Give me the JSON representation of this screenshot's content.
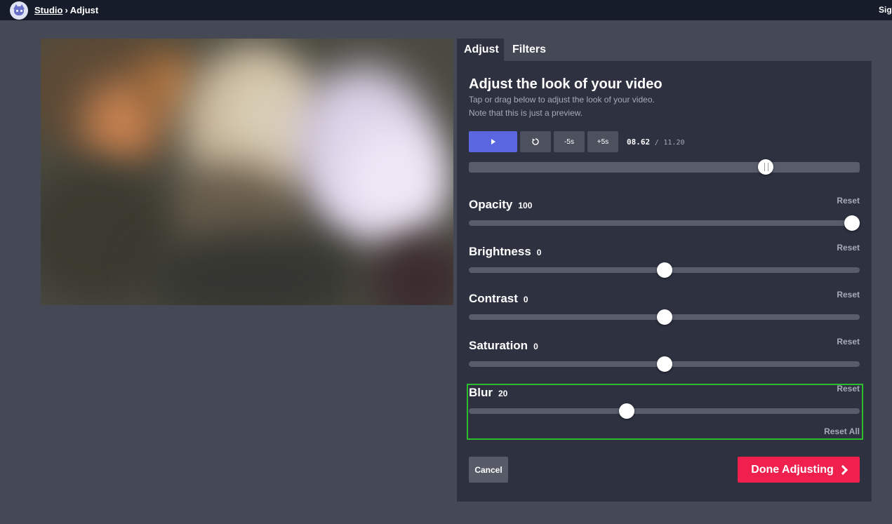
{
  "breadcrumb": {
    "studio": "Studio",
    "separator": "›",
    "current": "Adjust"
  },
  "header": {
    "signin_label": "Sign In"
  },
  "tabs": [
    {
      "label": "Adjust",
      "active": true
    },
    {
      "label": "Filters",
      "active": false
    }
  ],
  "panel": {
    "title": "Adjust the look of your video",
    "subtitle_1": "Tap or drag below to adjust the look of your video.",
    "subtitle_2": "Note that this is just a preview."
  },
  "playback": {
    "minus_label": "-5s",
    "plus_label": "+5s",
    "current_time": "08.62",
    "time_separator": "/",
    "total_time": "11.20",
    "position_fraction": 0.77
  },
  "sliders": [
    {
      "label": "Opacity",
      "value": "100",
      "fraction": 1.0,
      "reset_label": "Reset"
    },
    {
      "label": "Brightness",
      "value": "0",
      "fraction": 0.5,
      "reset_label": "Reset"
    },
    {
      "label": "Contrast",
      "value": "0",
      "fraction": 0.5,
      "reset_label": "Reset"
    },
    {
      "label": "Saturation",
      "value": "0",
      "fraction": 0.5,
      "reset_label": "Reset"
    },
    {
      "label": "Blur",
      "value": "20",
      "fraction": 0.4,
      "reset_label": "Reset"
    }
  ],
  "reset_all_label": "Reset All",
  "footer": {
    "cancel_label": "Cancel",
    "done_label": "Done Adjusting"
  },
  "colors": {
    "play_button": "#5b67e0",
    "done_button": "#ef1f4e",
    "highlight": "#2ebd2e"
  },
  "icons": {
    "play": "play-icon",
    "restart": "restart-icon",
    "done": "chevron-right-icon"
  }
}
